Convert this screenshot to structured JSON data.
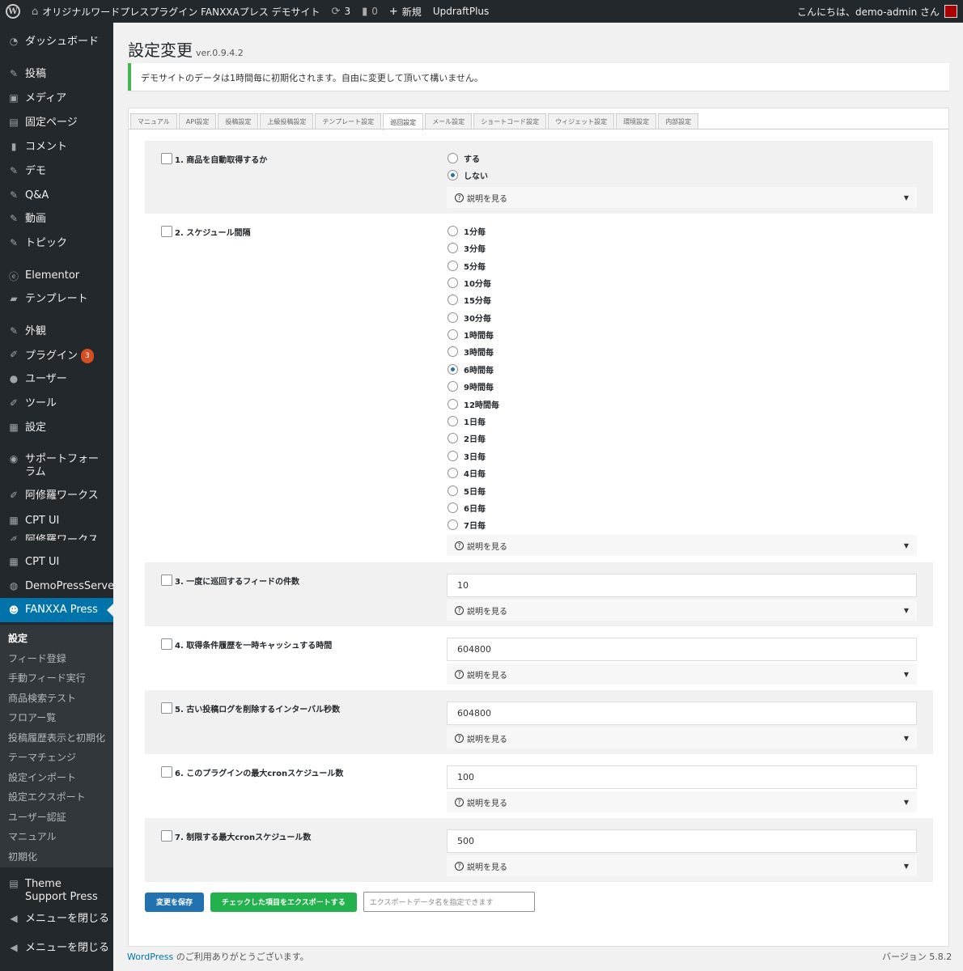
{
  "adminbar": {
    "site_name": "オリジナルワードプレスプラグイン FANXXAプレス デモサイト",
    "updates_count": "3",
    "comments_count": "0",
    "new_label": "新規",
    "updraft_label": "UpdraftPlus",
    "greeting": "こんにちは、demo-admin さん",
    "icons": {
      "wp": "wordpress-logo-icon",
      "home": "home-icon",
      "updates": "refresh-icon",
      "comments": "comment-icon",
      "new": "plus-icon"
    }
  },
  "sidebar": {
    "items": [
      {
        "label": "ダッシュボード",
        "icon": "dashboard-icon"
      },
      {
        "label": "投稿",
        "icon": "pin-icon"
      },
      {
        "label": "メディア",
        "icon": "media-icon"
      },
      {
        "label": "固定ページ",
        "icon": "page-icon"
      },
      {
        "label": "コメント",
        "icon": "comment-icon"
      },
      {
        "label": "デモ",
        "icon": "pin-icon"
      },
      {
        "label": "Q&A",
        "icon": "pin-icon"
      },
      {
        "label": "動画",
        "icon": "pin-icon"
      },
      {
        "label": "トピック",
        "icon": "pin-icon"
      },
      {
        "label": "Elementor",
        "icon": "elementor-icon"
      },
      {
        "label": "テンプレート",
        "icon": "folder-icon"
      },
      {
        "label": "外観",
        "icon": "brush-icon"
      },
      {
        "label": "プラグイン",
        "icon": "plugin-icon",
        "badge": "3"
      },
      {
        "label": "ユーザー",
        "icon": "user-icon"
      },
      {
        "label": "ツール",
        "icon": "wrench-icon"
      },
      {
        "label": "設定",
        "icon": "settings-icon"
      },
      {
        "label": "サポートフォーラム",
        "icon": "support-icon"
      },
      {
        "label": "阿修羅ワークス",
        "icon": "wrench-icon"
      },
      {
        "label": "CPT UI",
        "icon": "grid-icon"
      },
      {
        "label": "阿修羅ワークス",
        "icon": "wrench-icon"
      },
      {
        "label": "CPT UI",
        "icon": "grid-icon"
      },
      {
        "label": "DemoPressServer",
        "icon": "server-icon"
      },
      {
        "label": "FANXXA Press",
        "icon": "fanxxa-icon"
      },
      {
        "label": "Theme Support Press",
        "icon": "document-icon"
      },
      {
        "label": "メニューを閉じる",
        "icon": "collapse-icon"
      },
      {
        "label": "メニューを閉じる",
        "icon": "collapse-icon"
      }
    ],
    "submenu": [
      "設定",
      "フィード登録",
      "手動フィード実行",
      "商品検索テスト",
      "フロアー覧",
      "投稿履歴表示と初期化",
      "テーマチェンジ",
      "設定インポート",
      "設定エクスポート",
      "ユーザー認証",
      "マニュアル",
      "初期化"
    ]
  },
  "main": {
    "title": "設定変更",
    "version": "ver.0.9.4.2",
    "notice": "デモサイトのデータは1時間毎に初期化されます。自由に変更して頂いて構いません。",
    "tabs": [
      "マニュアル",
      "API設定",
      "投稿設定",
      "上級投稿設定",
      "テンプレート設定",
      "巡回設定",
      "メール設定",
      "ショートコード設定",
      "ウィジェット設定",
      "環境設定",
      "内部設定"
    ],
    "active_tab": 5,
    "details_label": "説明を見る",
    "settings": [
      {
        "label": "1. 商品を自動取得するか",
        "options": [
          "する",
          "しない"
        ],
        "selected": 1
      },
      {
        "label": "2. スケジュール間隔",
        "options": [
          "1分毎",
          "3分毎",
          "5分毎",
          "10分毎",
          "15分毎",
          "30分毎",
          "1時間毎",
          "3時間毎",
          "6時間毎",
          "9時間毎",
          "12時間毎",
          "1日毎",
          "2日毎",
          "3日毎",
          "4日毎",
          "5日毎",
          "6日毎",
          "7日毎"
        ],
        "selected": 8
      },
      {
        "label": "3. 一度に巡回するフィードの件数",
        "value": "10"
      },
      {
        "label": "4. 取得条件履歴を一時キャッシュする時間",
        "value": "604800"
      },
      {
        "label": "5. 古い投稿ログを削除するインターバル秒数",
        "value": "604800"
      },
      {
        "label": "6. このプラグインの最大cronスケジュール数",
        "value": "100"
      },
      {
        "label": "7. 制限する最大cronスケジュール数",
        "value": "500"
      }
    ],
    "save_button": "変更を保存",
    "export_button": "チェックした項目をエクスポートする",
    "export_placeholder": "エクスポートデータ名を指定できます"
  },
  "footer": {
    "wp_link": "WordPress",
    "thanks": " のご利用ありがとうございます。",
    "version": "バージョン 5.8.2"
  }
}
